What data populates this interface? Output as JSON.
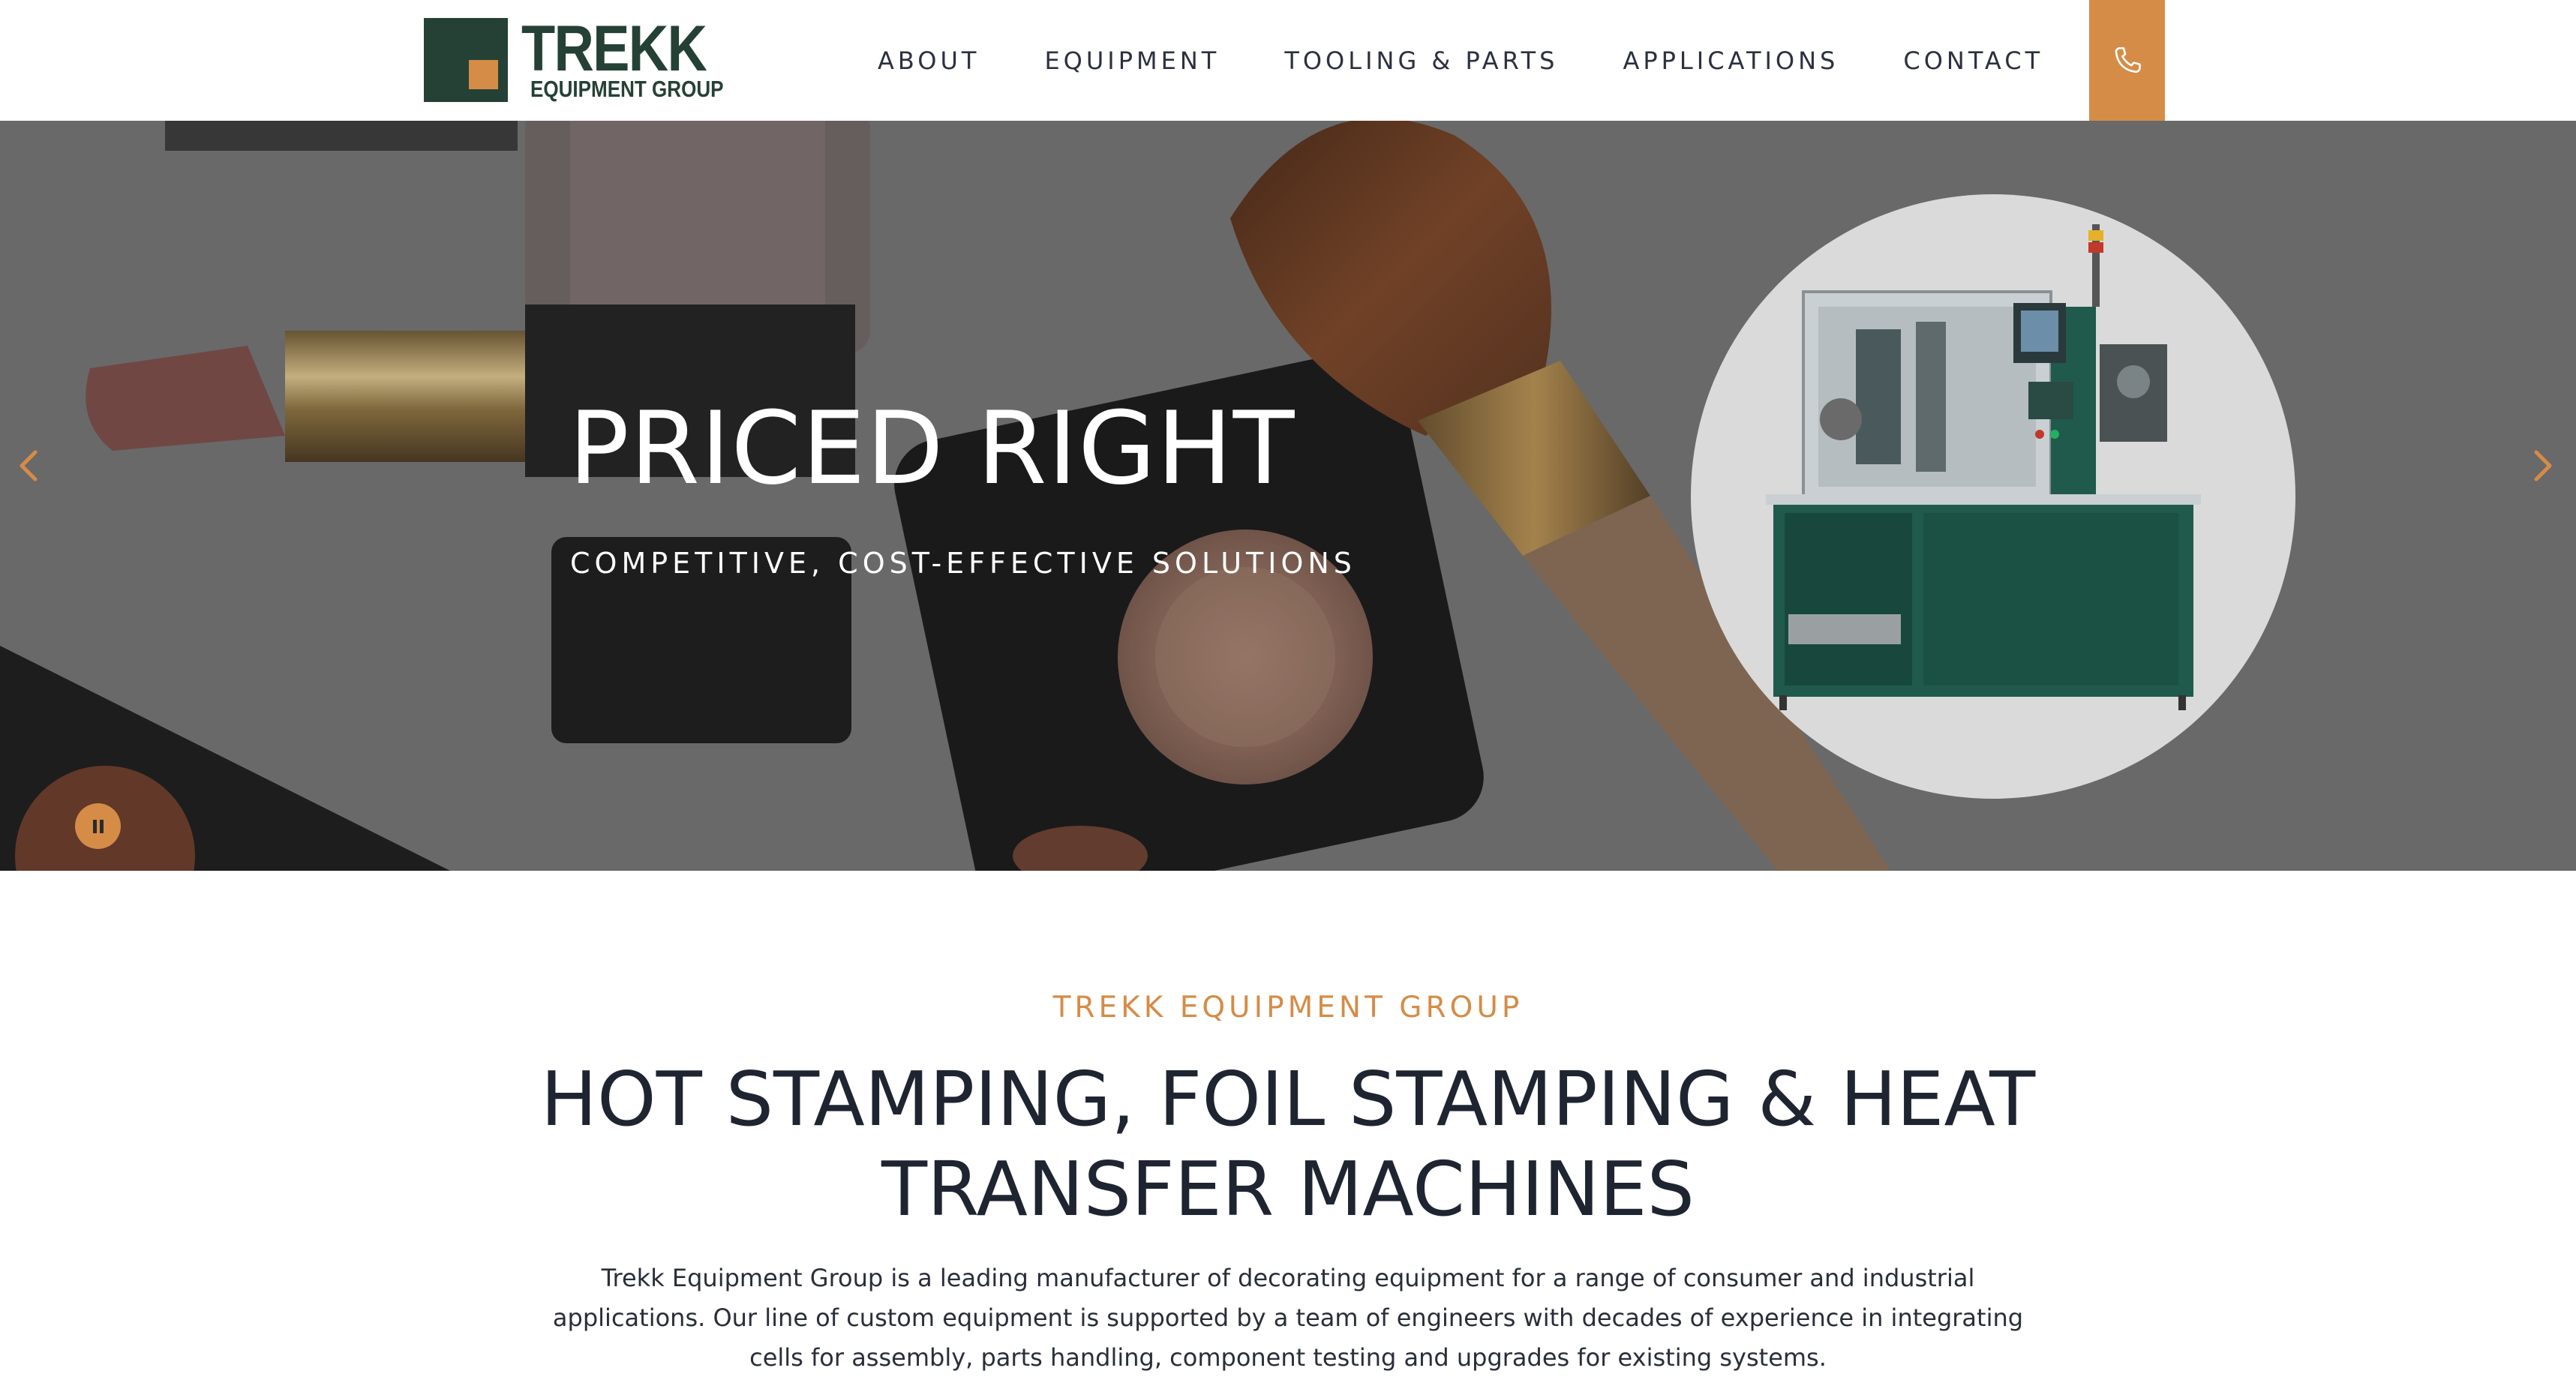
{
  "header": {
    "logo_word": "TREKK",
    "logo_sub": "EQUIPMENT GROUP",
    "nav": [
      "ABOUT",
      "EQUIPMENT",
      "TOOLING & PARTS",
      "APPLICATIONS",
      "CONTACT"
    ]
  },
  "hero": {
    "title": "PRICED RIGHT",
    "subtitle": "COMPETITIVE, COST-EFFECTIVE SOLUTIONS"
  },
  "intro": {
    "eyebrow": "TREKK EQUIPMENT GROUP",
    "headline": "HOT STAMPING, FOIL STAMPING & HEAT TRANSFER MACHINES",
    "body": "Trekk Equipment Group is a leading manufacturer of decorating equipment for a range of consumer and industrial applications. Our line of custom equipment is supported by a team of engineers with decades of experience in integrating cells for assembly, parts handling, component testing and upgrades for existing systems."
  },
  "colors": {
    "accent": "#d58c47",
    "brand_green": "#254136",
    "text_dark": "#1f2431"
  },
  "icons": {
    "phone": "phone-icon",
    "prev": "chevron-left-icon",
    "next": "chevron-right-icon",
    "pause": "pause-icon"
  }
}
